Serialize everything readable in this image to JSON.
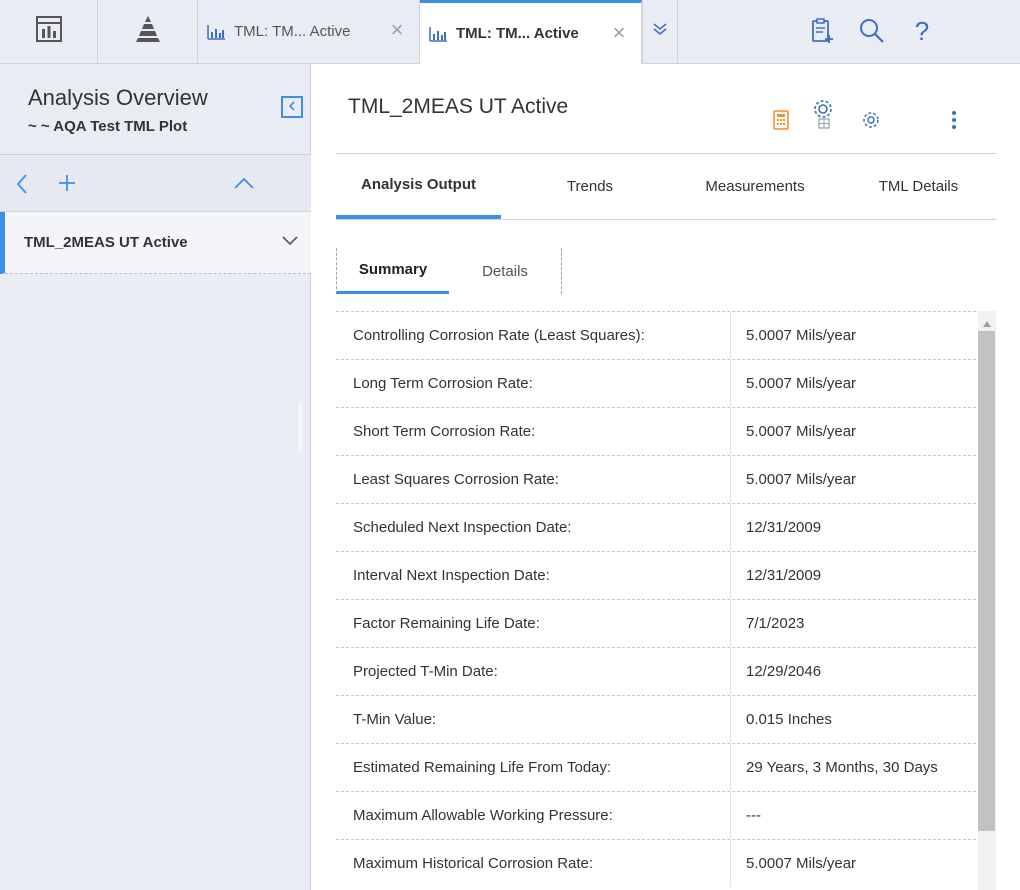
{
  "topbar": {
    "home_icon": "dashboard-icon",
    "apps_icon": "pyramid-icon",
    "tabs": [
      {
        "label": "TML: TM... Active",
        "icon": "chart-icon",
        "close": "×"
      },
      {
        "label": "TML: TM... Active",
        "icon": "chart-icon",
        "close": "×"
      }
    ],
    "overflow_icon": "double-chevron-down-icon",
    "right_icons": [
      "clipboard-add-icon",
      "search-icon",
      "help-icon"
    ],
    "help_glyph": "?"
  },
  "sidebar": {
    "title": "Analysis Overview",
    "subtitle": "~ ~ AQA Test TML Plot",
    "item": "TML_2MEAS UT Active"
  },
  "main": {
    "title": "TML_2MEAS UT Active",
    "tabs": [
      "Analysis Output",
      "Trends",
      "Measurements",
      "TML Details"
    ],
    "subtabs": [
      "Summary",
      "Details"
    ],
    "rows": [
      {
        "label": "Controlling Corrosion Rate (Least Squares):",
        "value": "5.0007 Mils/year"
      },
      {
        "label": "Long Term Corrosion Rate:",
        "value": "5.0007 Mils/year"
      },
      {
        "label": "Short Term Corrosion Rate:",
        "value": "5.0007 Mils/year"
      },
      {
        "label": "Least Squares Corrosion Rate:",
        "value": "5.0007 Mils/year"
      },
      {
        "label": "Scheduled Next Inspection Date:",
        "value": "12/31/2009"
      },
      {
        "label": "Interval Next Inspection Date:",
        "value": "12/31/2009"
      },
      {
        "label": "Factor Remaining Life Date:",
        "value": "7/1/2023"
      },
      {
        "label": "Projected T-Min Date:",
        "value": "12/29/2046"
      },
      {
        "label": "T-Min Value:",
        "value": "0.015 Inches"
      },
      {
        "label": "Estimated Remaining Life From Today:",
        "value": "29 Years, 3 Months, 30 Days"
      },
      {
        "label": "Maximum Allowable Working Pressure:",
        "value": "---"
      },
      {
        "label": "Maximum Historical Corrosion Rate:",
        "value": "5.0007 Mils/year"
      }
    ]
  },
  "colors": {
    "accent": "#3c8fe8",
    "calculator": "#f0922f",
    "icon_blue": "#3c6fc4"
  }
}
